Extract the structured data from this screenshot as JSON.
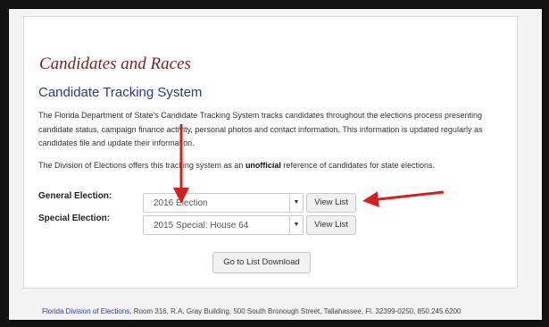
{
  "page": {
    "title": "Candidates and Races",
    "system_title": "Candidate Tracking System",
    "description1": "The Florida Department of State's Candidate Tracking System tracks candidates throughout the elections process presenting candidate status, campaign finance activity,  personal photos and contact information. This information is updated regularly as candidates file and update their information.",
    "description2_before": "The Division of Elections offers this tracking system as an ",
    "description2_bold": "unofficial",
    "description2_after": " reference of candidates for state elections."
  },
  "general_election": {
    "label": "General Election:",
    "selected": "2016 Election",
    "button": "View List"
  },
  "special_election": {
    "label": "Special Election:",
    "selected": "2015 Special: House 64",
    "button": "View List"
  },
  "download_button": "Go to List Download",
  "footer": {
    "link": "Florida Division of Elections",
    "address": ", Room 316, R.A. Gray Building, 500 South Bronough Street, Tallahassee, Fl. 32399-0250, 850.245.6200"
  },
  "colors": {
    "title": "#7a2222",
    "system_title": "#2a3a8a",
    "arrow": "#d42020",
    "link": "#2a3a9a"
  }
}
